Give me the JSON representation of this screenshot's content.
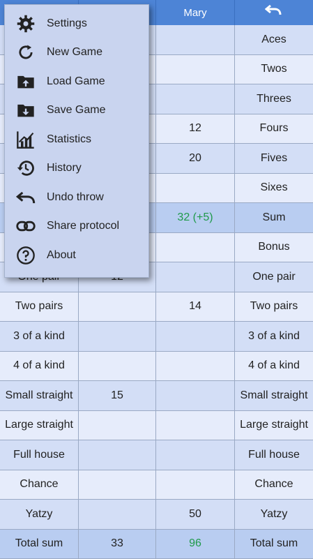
{
  "header": {
    "player2": "Mary",
    "undo_icon": "undo-icon"
  },
  "rows": [
    {
      "label": "Aces",
      "p1": "",
      "p2": "",
      "label_r": "Aces"
    },
    {
      "label": "Twos",
      "p1": "",
      "p2": "",
      "label_r": "Twos"
    },
    {
      "label": "Threes",
      "p1": "",
      "p2": "",
      "label_r": "Threes"
    },
    {
      "label": "Fours",
      "p1": "",
      "p2": "12",
      "label_r": "Fours"
    },
    {
      "label": "Fives",
      "p1": "",
      "p2": "20",
      "label_r": "Fives"
    },
    {
      "label": "Sixes",
      "p1": "",
      "p2": "",
      "label_r": "Sixes"
    },
    {
      "label": "Sum",
      "p1": "",
      "p2": "32 (+5)",
      "label_r": "Sum"
    },
    {
      "label": "Bonus",
      "p1": "",
      "p2": "",
      "label_r": "Bonus"
    },
    {
      "label": "One pair",
      "p1": "12",
      "p2": "",
      "label_r": "One pair"
    },
    {
      "label": "Two pairs",
      "p1": "",
      "p2": "14",
      "label_r": "Two pairs"
    },
    {
      "label": "3 of a kind",
      "p1": "",
      "p2": "",
      "label_r": "3 of a kind"
    },
    {
      "label": "4 of a kind",
      "p1": "",
      "p2": "",
      "label_r": "4 of a kind"
    },
    {
      "label": "Small straight",
      "p1": "15",
      "p2": "",
      "label_r": "Small straight"
    },
    {
      "label": "Large straight",
      "p1": "",
      "p2": "",
      "label_r": "Large straight"
    },
    {
      "label": "Full house",
      "p1": "",
      "p2": "",
      "label_r": "Full house"
    },
    {
      "label": "Chance",
      "p1": "",
      "p2": "",
      "label_r": "Chance"
    },
    {
      "label": "Yatzy",
      "p1": "",
      "p2": "50",
      "label_r": "Yatzy"
    },
    {
      "label": "Total sum",
      "p1": "33",
      "p2": "96",
      "label_r": "Total sum"
    }
  ],
  "menu": {
    "items": [
      {
        "label": "Settings",
        "icon": "gear-icon"
      },
      {
        "label": "New Game",
        "icon": "refresh-icon"
      },
      {
        "label": "Load Game",
        "icon": "folder-upload-icon"
      },
      {
        "label": "Save Game",
        "icon": "folder-download-icon"
      },
      {
        "label": "Statistics",
        "icon": "chart-icon"
      },
      {
        "label": "History",
        "icon": "history-icon"
      },
      {
        "label": "Undo throw",
        "icon": "undo-icon"
      },
      {
        "label": "Share protocol",
        "icon": "link-icon"
      },
      {
        "label": "About",
        "icon": "help-icon"
      }
    ]
  },
  "colors": {
    "header": "#4d84d6",
    "row_light": "#e6ecfb",
    "row_dark": "#d3def6",
    "sum_row": "#b9cdf1",
    "green_text": "#1f9a4a",
    "menu_bg": "#c9d4ef"
  }
}
